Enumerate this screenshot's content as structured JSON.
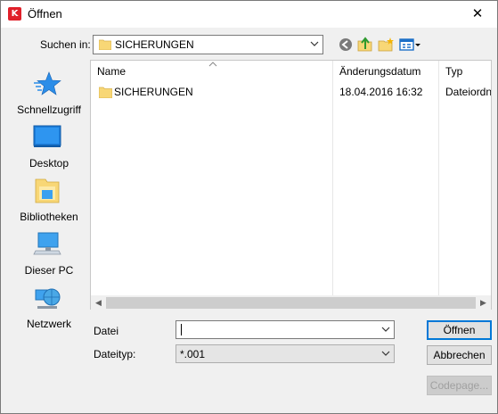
{
  "window": {
    "title": "Öffnen",
    "close_glyph": "✕",
    "app_icon_letter": "K"
  },
  "lookin": {
    "label": "Suchen in:",
    "value": "SICHERUNGEN"
  },
  "toolbar": {
    "icons": [
      "back-icon",
      "up-folder-icon",
      "new-folder-icon",
      "view-menu-icon"
    ]
  },
  "places": [
    {
      "label": "Schnellzugriff",
      "icon": "star-icon"
    },
    {
      "label": "Desktop",
      "icon": "desktop-icon"
    },
    {
      "label": "Bibliotheken",
      "icon": "libraries-icon"
    },
    {
      "label": "Dieser PC",
      "icon": "computer-icon"
    },
    {
      "label": "Netzwerk",
      "icon": "network-icon"
    }
  ],
  "filelist": {
    "columns": [
      "Name",
      "Änderungsdatum",
      "Typ"
    ],
    "rows": [
      {
        "name": "SICHERUNGEN",
        "date": "18.04.2016 16:32",
        "type": "Dateiordn"
      }
    ]
  },
  "filename": {
    "label": "Datei",
    "value": ""
  },
  "filetype": {
    "label": "Dateityp:",
    "value": "*.001"
  },
  "buttons": {
    "open": "Öffnen",
    "cancel": "Abbrechen",
    "codepage": "Codepage..."
  },
  "colors": {
    "accent": "#0078d7",
    "folder": "#f8d776",
    "app_icon": "#e0202a"
  }
}
